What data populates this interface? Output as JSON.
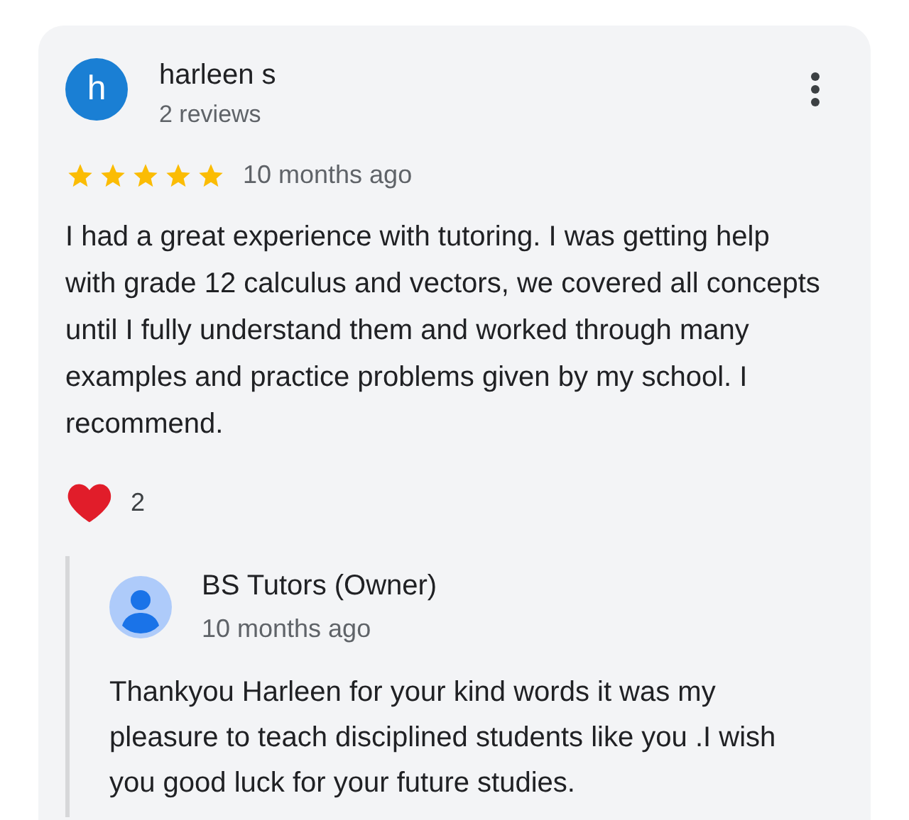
{
  "review": {
    "author": {
      "initial": "h",
      "name": "harleen s",
      "meta": "2 reviews"
    },
    "stars": 5,
    "time": "10 months ago",
    "text": "I had a great experience with tutoring. I was getting help with grade 12 calculus and vectors, we covered all concepts until I fully understand them and worked through many examples and practice problems given by my school. I recommend.",
    "reactions": "2",
    "reply": {
      "name": "BS Tutors (Owner)",
      "time": "10 months ago",
      "text": "Thankyou Harleen for your kind words it was my pleasure to teach disciplined students like you .I wish you good luck for your future studies."
    }
  }
}
